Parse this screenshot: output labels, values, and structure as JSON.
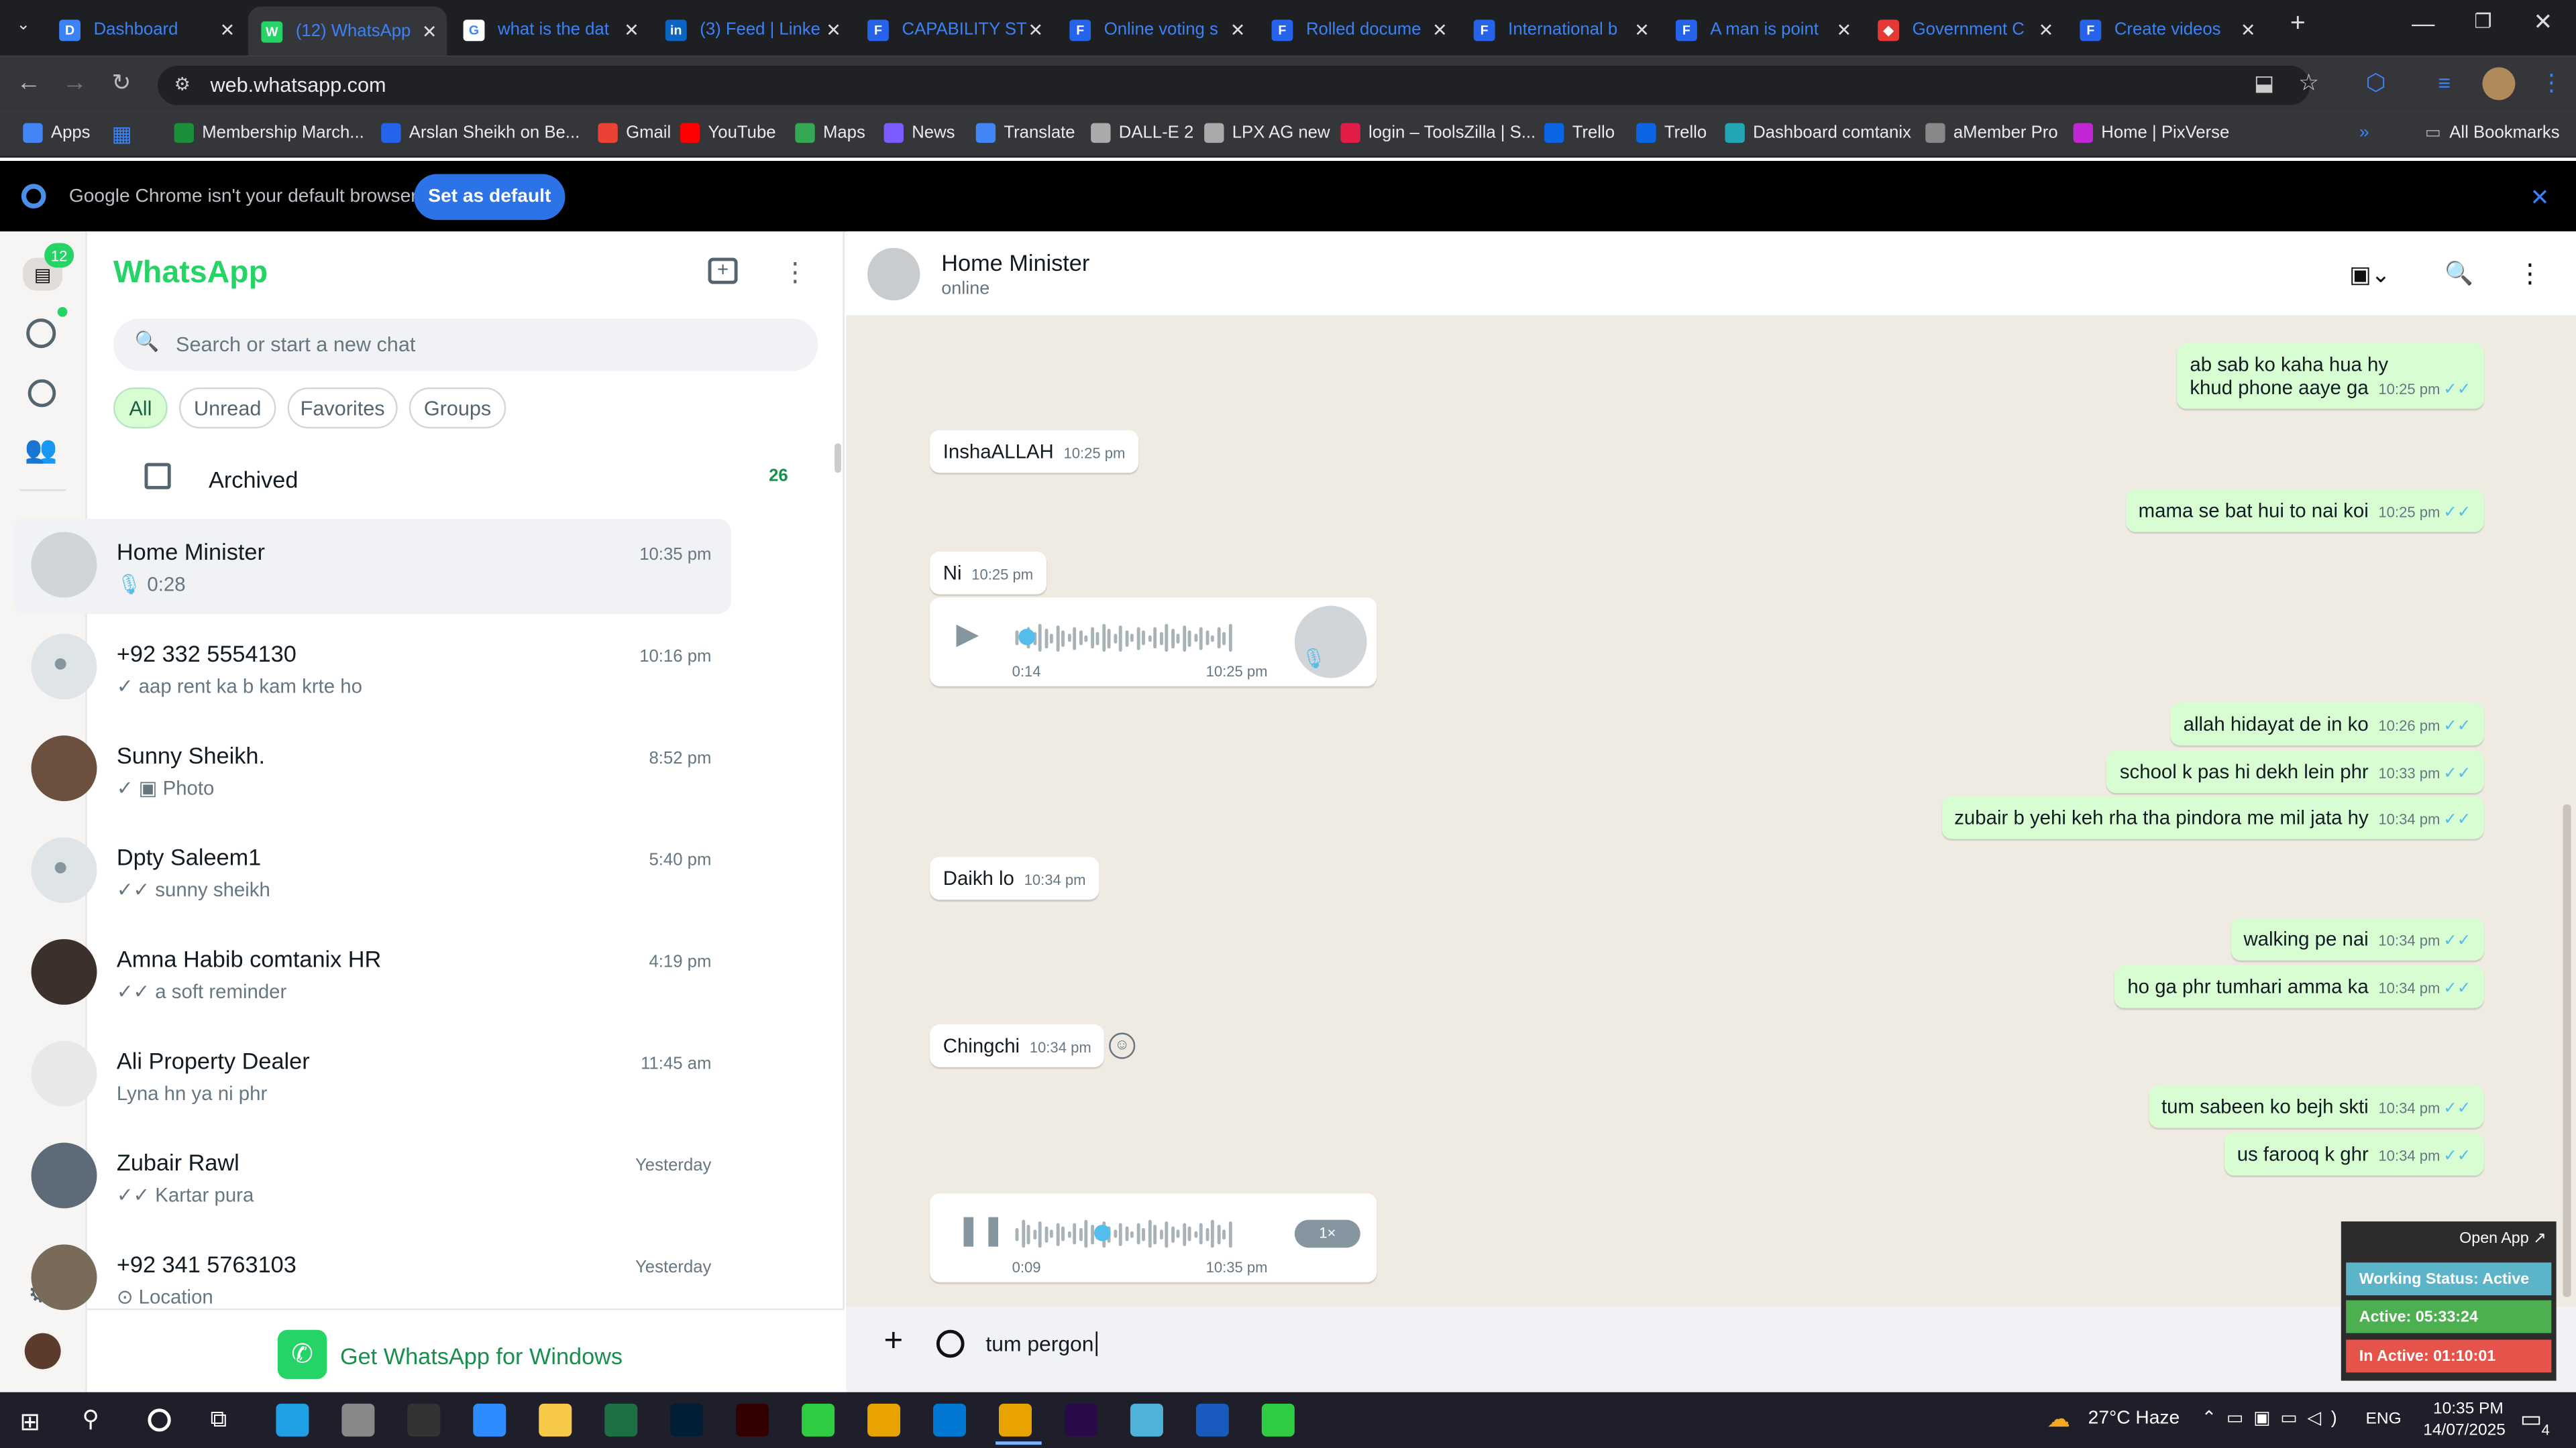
{
  "browser": {
    "tabs": [
      {
        "label": "Dashboard",
        "color": "#3b82f6",
        "icon": "D"
      },
      {
        "label": "(12) WhatsApp",
        "color": "#25d366",
        "icon": "W"
      },
      {
        "label": "what is the dat",
        "color": "#ffffff",
        "icon": "G"
      },
      {
        "label": "(3) Feed | Linke",
        "color": "#0a66c2",
        "icon": "in"
      },
      {
        "label": "CAPABILITY ST",
        "color": "#2563eb",
        "icon": "F"
      },
      {
        "label": "Online voting s",
        "color": "#2563eb",
        "icon": "F"
      },
      {
        "label": "Rolled docume",
        "color": "#2563eb",
        "icon": "F"
      },
      {
        "label": "International b",
        "color": "#2563eb",
        "icon": "F"
      },
      {
        "label": "A man is point",
        "color": "#2563eb",
        "icon": "F"
      },
      {
        "label": "Government C",
        "color": "#e53935",
        "icon": "◆"
      },
      {
        "label": "Create videos",
        "color": "#2563eb",
        "icon": "F"
      }
    ],
    "url": "web.whatsapp.com",
    "bookmarks": [
      "Apps",
      "Membership March...",
      "Arslan Sheikh on Be...",
      "Gmail",
      "YouTube",
      "Maps",
      "News",
      "Translate",
      "DALL-E 2",
      "LPX AG new",
      "login – ToolsZilla | S...",
      "Trello",
      "Trello",
      "Dashboard comtanix",
      "aMember Pro",
      "Home | PixVerse"
    ],
    "all_bookmarks": "All Bookmarks",
    "infobar_text": "Google Chrome isn't your default browser",
    "infobar_button": "Set as default"
  },
  "rail": {
    "badge": "12"
  },
  "list": {
    "title": "WhatsApp",
    "search_placeholder": "Search or start a new chat",
    "filters": [
      "All",
      "Unread",
      "Favorites",
      "Groups"
    ],
    "archived": {
      "label": "Archived",
      "count": "26"
    },
    "chats": [
      {
        "name": "Home Minister",
        "preview": "0:28",
        "time": "10:35 pm"
      },
      {
        "name": "+92 332 5554130",
        "preview": "✓ aap rent ka b kam krte ho",
        "time": "10:16 pm"
      },
      {
        "name": "Sunny Sheikh.",
        "preview": "✓ ▣ Photo",
        "time": "8:52 pm"
      },
      {
        "name": "Dpty Saleem1",
        "preview": "✓✓ sunny sheikh",
        "time": "5:40 pm"
      },
      {
        "name": "Amna Habib comtanix HR",
        "preview": "✓✓ a soft reminder",
        "time": "4:19 pm"
      },
      {
        "name": "Ali Property Dealer",
        "preview": "Lyna hn ya ni phr",
        "time": "11:45 am"
      },
      {
        "name": "Zubair Rawl",
        "preview": "✓✓ Kartar pura",
        "time": "Yesterday"
      },
      {
        "name": "+92 341 5763103",
        "preview": "⊙ Location",
        "time": "Yesterday"
      }
    ],
    "get_app": "Get WhatsApp for Windows"
  },
  "chat": {
    "name": "Home Minister",
    "status": "online",
    "messages": [
      {
        "dir": "out",
        "text": "ab sab ko kaha hua hy",
        "text2": "khud phone aaye ga",
        "time": "10:25 pm"
      },
      {
        "dir": "in",
        "text": "InshaALLAH",
        "time": "10:25 pm"
      },
      {
        "dir": "out",
        "text": "mama se bat hui to nai koi",
        "time": "10:25 pm"
      },
      {
        "dir": "in",
        "text": "Ni",
        "time": "10:25 pm"
      },
      {
        "dir": "in",
        "voice": "0:14",
        "time": "10:25 pm"
      },
      {
        "dir": "out",
        "text": "allah hidayat de in ko",
        "time": "10:26 pm"
      },
      {
        "dir": "out",
        "text": "school k pas hi dekh lein phr",
        "time": "10:33 pm"
      },
      {
        "dir": "out",
        "text": "zubair b yehi keh rha tha pindora me mil jata hy",
        "time": "10:34 pm"
      },
      {
        "dir": "in",
        "text": "Daikh lo",
        "time": "10:34 pm"
      },
      {
        "dir": "out",
        "text": "walking pe nai",
        "time": "10:34 pm"
      },
      {
        "dir": "out",
        "text": "ho ga phr tumhari amma ka",
        "time": "10:34 pm"
      },
      {
        "dir": "in",
        "text": "Chingchi",
        "time": "10:34 pm"
      },
      {
        "dir": "out",
        "text": "tum sabeen ko bejh skti",
        "time": "10:34 pm"
      },
      {
        "dir": "out",
        "text": "us farooq k ghr",
        "time": "10:34 pm"
      },
      {
        "dir": "in",
        "voice": "0:09",
        "time": "10:35 pm",
        "speed": "1×"
      }
    ],
    "draft": "tum pergon"
  },
  "widget": {
    "open": "Open App ↗",
    "working": "Working Status: Active",
    "active": "Active: 05:33:24",
    "inactive": "In Active: 01:10:01"
  },
  "taskbar": {
    "weather": "27°C  Haze",
    "lang": "ENG",
    "time": "10:35 PM",
    "date": "14/07/2025",
    "notif": "4"
  }
}
